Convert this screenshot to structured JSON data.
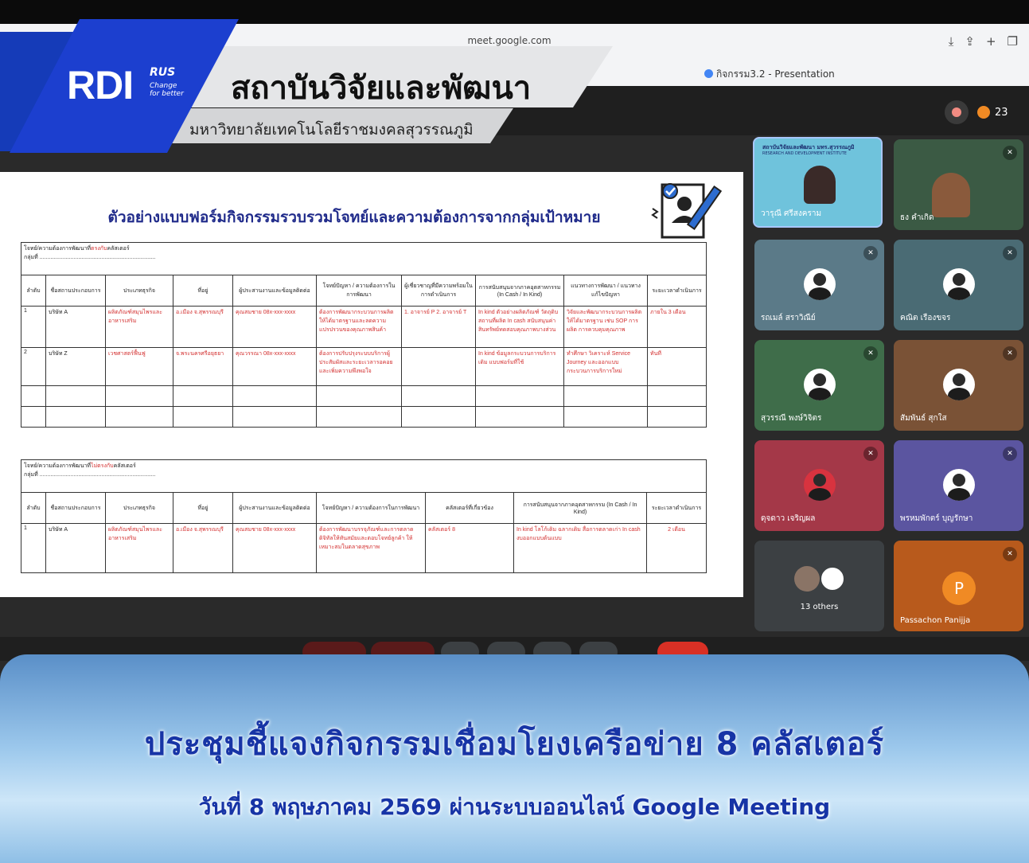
{
  "browser": {
    "url": "meet.google.com",
    "tab_title": "กิจกรรม3.2 - Presentation"
  },
  "meet": {
    "participant_count": "23"
  },
  "logo": {
    "rdi": "RDI",
    "rus": "RUS",
    "tagline_1": "Change",
    "tagline_2": "for better",
    "institute": "สถาบันวิจัยและพัฒนา",
    "university": "มหาวิทยาลัยเทคโนโลยีราชมงคลสุวรรณภูมิ"
  },
  "slide": {
    "title": "ตัวอย่างแบบฟอร์มกิจกรรมรวบรวมโจทย์และความต้องการจากกลุ่มเป้าหมาย",
    "table1": {
      "caption_prefix": "โจทย์/ความต้องการพัฒนาที่",
      "caption_red": "ตรงกับ",
      "caption_suffix": "คลัสเตอร์",
      "group_label": "กลุ่มที่ ...........................................................................",
      "headers": [
        "ลำดับ",
        "ชื่อสถานประกอบการ",
        "ประเภทธุรกิจ",
        "ที่อยู่",
        "ผู้ประสานงานและข้อมูลติดต่อ",
        "โจทย์ปัญหา / ความต้องการในการพัฒนา",
        "ผู้เชี่ยวชาญที่มีความพร้อมในการดำเนินการ",
        "การสนับสนุนจากภาคอุตสาหกรรม (In Cash / In Kind)",
        "แนวทางการพัฒนา / แนวทางแก้ไขปัญหา",
        "ระยะเวลาดำเนินการ"
      ],
      "rows": [
        [
          "1",
          "บริษัท A",
          "ผลิตภัณฑ์สมุนไพรและอาหารเสริม",
          "อ.เมือง จ.สุพรรณบุรี",
          "คุณสมชาย 08x-xxx-xxxx",
          "ต้องการพัฒนากระบวนการผลิตให้ได้มาตรฐานและลดความแปรปรวนของคุณภาพสินค้า",
          "1. อาจารย์ P 2. อาจารย์ T",
          "In kind ตัวอย่างผลิตภัณฑ์ วัตถุดิบ สถานที่ผลิต In cash สนับสนุนค่าสินทรัพย์ทดสอบคุณภาพบางส่วน",
          "วิจัยและพัฒนากระบวนการผลิตให้ได้มาตรฐาน เช่น SOP การผลิต การควบคุมคุณภาพ",
          "ภายใน 3 เดือน"
        ],
        [
          "2",
          "บริษัท Z",
          "เวชศาสตร์ฟื้นฟู",
          "จ.พระนครศรีอยุธยา",
          "คุณวรรณา 08x-xxx-xxxx",
          "ต้องการปรับปรุงระบบบริการผู้ประสัมผัสและระยะเวลารอคอยและเพิ่มความพึงพอใจ",
          "",
          "In kind ข้อมูลกระบวนการบริการเดิม แบบฟอร์มที่ใช้",
          "ทำศึกษา วิเคราะห์ Service Journey และออกแบบกระบวนการบริการใหม่",
          "ทันที"
        ],
        [
          "",
          "",
          "",
          "",
          "",
          "",
          "",
          "",
          "",
          ""
        ],
        [
          "",
          "",
          "",
          "",
          "",
          "",
          "",
          "",
          "",
          ""
        ]
      ]
    },
    "table2": {
      "caption_prefix": "โจทย์/ความต้องการพัฒนาที่",
      "caption_red": "ไม่ตรงกับ",
      "caption_suffix": "คลัสเตอร์",
      "group_label": "กลุ่มที่ ...........................................................................",
      "headers": [
        "ลำดับ",
        "ชื่อสถานประกอบการ",
        "ประเภทธุรกิจ",
        "ที่อยู่",
        "ผู้ประสานงานและข้อมูลติดต่อ",
        "โจทย์ปัญหา / ความต้องการในการพัฒนา",
        "คลัสเตอร์ที่เกี่ยวข้อง",
        "การสนับสนุนจากภาคอุตสาหกรรม (In Cash / In Kind)",
        "ระยะเวลาดำเนินการ"
      ],
      "rows": [
        [
          "1",
          "บริษัท A",
          "ผลิตภัณฑ์สมุนไพรและอาหารเสริม",
          "อ.เมือง จ.สุพรรณบุรี",
          "คุณสมชาย 08x-xxx-xxxx",
          "ต้องการพัฒนาบรรจุภัณฑ์และการตลาดดิจิทัลให้ทันสมัยและตอบโจทย์ลูกค้า ให้เหมาะสมในตลาดสุขภาพ",
          "คลัสเตอร์ 8",
          "In kind โลโก้เดิม ฉลากเดิม สื่อการตลาดเก่า In cash งบออกแบบต้นแบบ",
          "2 เดือน"
        ]
      ]
    }
  },
  "participants": [
    {
      "name": "วารุณี ศรีสงคราม",
      "tile_label": "สถาบันวิจัยและพัฒนา มทร.สุวรรณภูมิ",
      "tile_sub": "RESEARCH AND DEVELOPMENT INSTITUTE",
      "color": "#6fc3dc"
    },
    {
      "name": "ธง คำเกิด",
      "color": "#3b5a44"
    },
    {
      "name": "รถเมล์ สราวิณีย์",
      "color": "#5b7a88"
    },
    {
      "name": "คณิต เรืองขจร",
      "color": "#4a6b74"
    },
    {
      "name": "สุวรรณี พงษ์วิจิตร",
      "color": "#3f6d4a"
    },
    {
      "name": "สัมพันธ์ สุกใส",
      "color": "#7a5236"
    },
    {
      "name": "ดุจดาว เจริญผล",
      "color": "#a43848"
    },
    {
      "name": "พรหมพักตร์ บุญรักษา",
      "color": "#5b55a0"
    },
    {
      "name": "",
      "others_label": "13 others",
      "color": "#3c4043"
    },
    {
      "name": "Passachon Panijja",
      "initial": "P",
      "color": "#b85a1c"
    }
  ],
  "banner": {
    "line1": "ประชุมชี้แจงกิจกรรมเชื่อมโยงเครือข่าย 8 คลัสเตอร์",
    "line2": "วันที่ 8 พฤษภาคม 2569 ผ่านระบบออนไลน์ Google Meeting"
  },
  "colors": {
    "logo_blue": "#1c3fcf",
    "slide_title": "#1f2a8a",
    "banner_text": "#1734a6"
  }
}
